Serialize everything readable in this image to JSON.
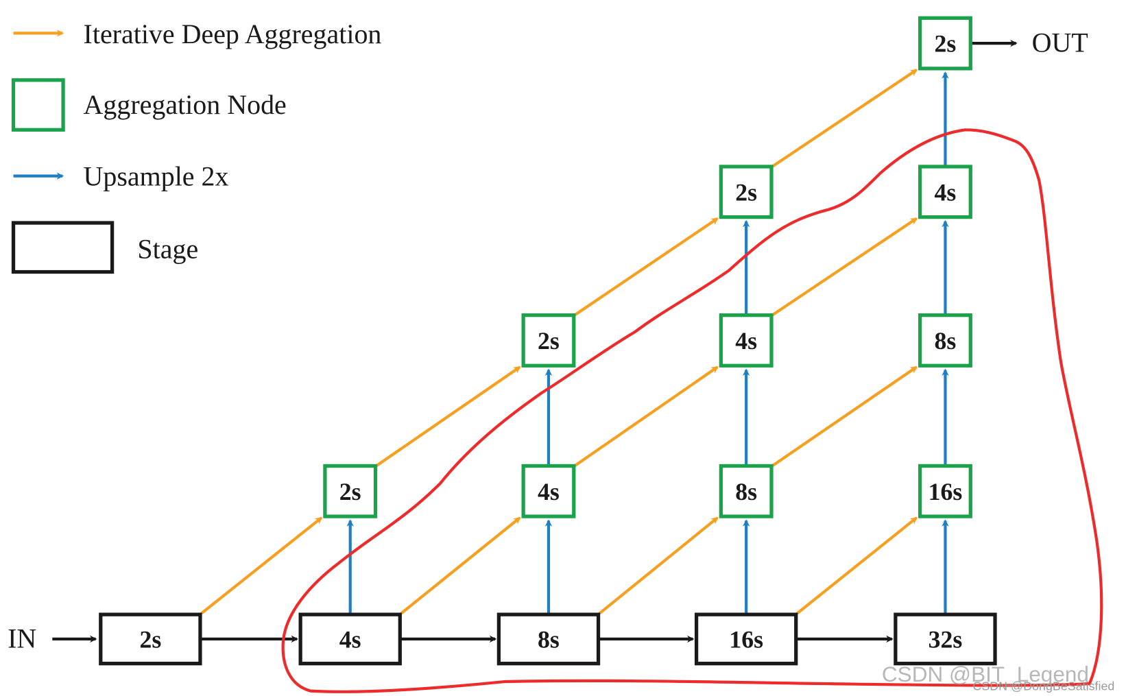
{
  "legend": {
    "ida": "Iterative Deep Aggregation",
    "node": "Aggregation Node",
    "upsample": "Upsample 2x",
    "stage": "Stage"
  },
  "io": {
    "in": "IN",
    "out": "OUT"
  },
  "stages": [
    "2s",
    "4s",
    "8s",
    "16s",
    "32s"
  ],
  "aggregation_rows": [
    [
      "2s",
      "4s",
      "8s",
      "16s"
    ],
    [
      "2s",
      "4s",
      "8s"
    ],
    [
      "2s",
      "4s"
    ],
    [
      "2s"
    ]
  ],
  "watermarks": [
    "CSDN @BIT_Legend",
    "CSDN @DongBeSatisfied"
  ],
  "colors": {
    "ida_arrow": "#f5a020",
    "upsample_arrow": "#1f7fc4",
    "aggregation_node": "#1aa34a",
    "stage": "#1a1a1a",
    "annotation_curve": "#ee2b2b"
  }
}
